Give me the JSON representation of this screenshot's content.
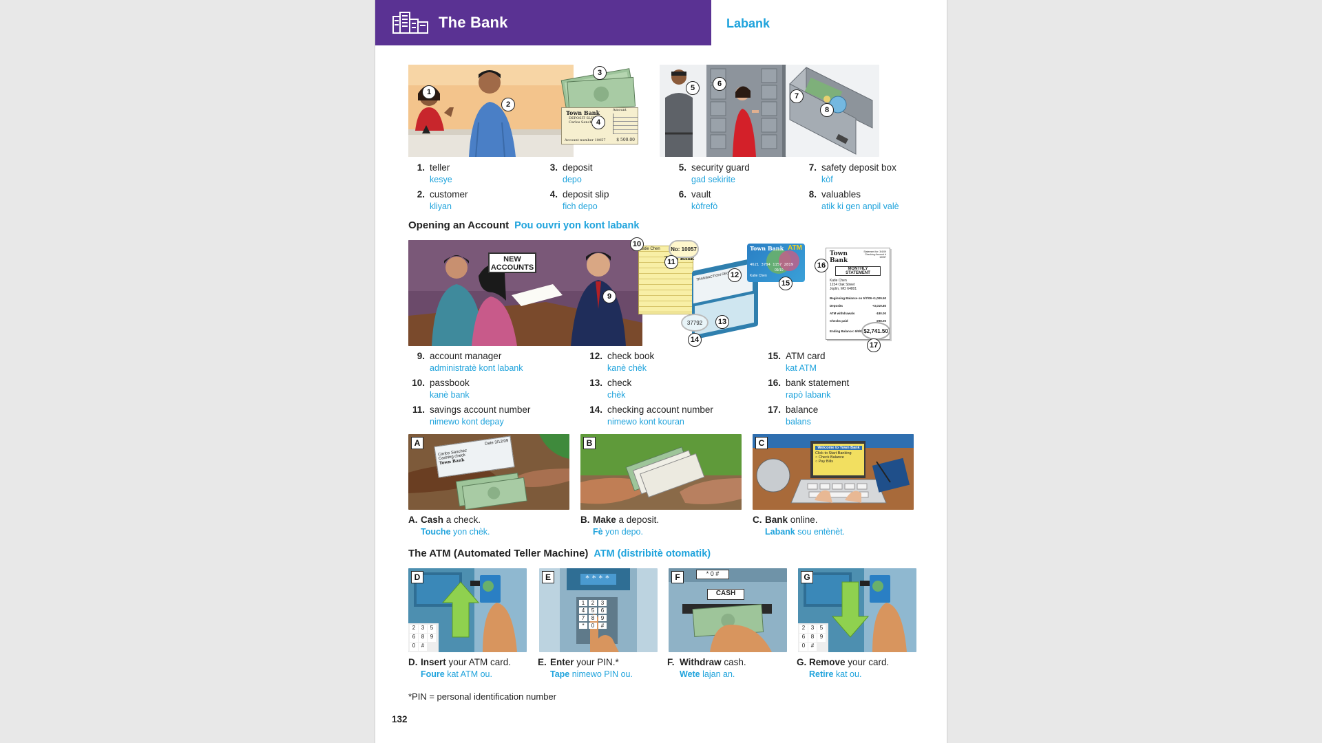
{
  "header": {
    "title": "The Bank",
    "title_ht": "Labank"
  },
  "section1": {
    "terms": [
      {
        "num": "1.",
        "en": "teller",
        "ht": "kesye"
      },
      {
        "num": "2.",
        "en": "customer",
        "ht": "kliyan"
      },
      {
        "num": "3.",
        "en": "deposit",
        "ht": "depo"
      },
      {
        "num": "4.",
        "en": "deposit slip",
        "ht": "fich depo"
      },
      {
        "num": "5.",
        "en": "security guard",
        "ht": "gad sekirite"
      },
      {
        "num": "6.",
        "en": "vault",
        "ht": "kòfrefò"
      },
      {
        "num": "7.",
        "en": "safety deposit box",
        "ht": "kòf"
      },
      {
        "num": "8.",
        "en": "valuables",
        "ht": "atik ki gen anpil valè"
      }
    ],
    "slip": {
      "bank": "Town Bank",
      "label": "DEPOSIT SLIP",
      "name": "Carlos Sanchez",
      "account_label": "Account number",
      "account": "10057",
      "amount": "500.00",
      "currency": "$",
      "amount_header": "Amount"
    }
  },
  "section2": {
    "heading": "Opening an Account",
    "heading_ht": "Pou ouvri yon kont labank",
    "sign": "NEW ACCOUNTS",
    "passbook": {
      "no": "No: 10057",
      "name": "Katie Chen",
      "bank": "Town Bank"
    },
    "checkbook": {
      "label": "TRANSACTION REGISTER",
      "account": "37792"
    },
    "atm_card": {
      "bank": "Town Bank",
      "brand": "ATM",
      "number": "4621 3784 1157 2819",
      "exp": "09/10",
      "name": "Katie Chen"
    },
    "statement": {
      "bank": "Town Bank",
      "statement_for": "Statement for: 3/4/09",
      "checking_account": "Checking Account # 10057",
      "title": "MONTHLY STATEMENT",
      "address": [
        "Katie Chen",
        "1234 Oak Street",
        "Joplin, MO 64801"
      ],
      "rows": [
        {
          "label": "Beginning Balance on 5/7/09",
          "value": "+1,009.50"
        },
        {
          "label": "Deposits",
          "value": "+3,019.80"
        },
        {
          "label": "ATM withdrawals",
          "value": "-180.00"
        },
        {
          "label": "Checks paid",
          "value": "-298.00"
        },
        {
          "label": "Ending Balance: 6/9/09",
          "value": ""
        }
      ],
      "balance": "$2,741.50"
    },
    "terms": [
      {
        "num": "9.",
        "en": "account manager",
        "ht": "administratè kont labank"
      },
      {
        "num": "10.",
        "en": "passbook",
        "ht": "kanè bank"
      },
      {
        "num": "11.",
        "en": "savings account number",
        "ht": "nimewo kont depay"
      },
      {
        "num": "12.",
        "en": "check book",
        "ht": "kanè chèk"
      },
      {
        "num": "13.",
        "en": "check",
        "ht": "chèk"
      },
      {
        "num": "14.",
        "en": "checking account number",
        "ht": "nimewo kont kouran"
      },
      {
        "num": "15.",
        "en": "ATM card",
        "ht": "kat ATM"
      },
      {
        "num": "16.",
        "en": "bank statement",
        "ht": "rapò labank"
      },
      {
        "num": "17.",
        "en": "balance",
        "ht": "balans"
      }
    ]
  },
  "actions1": [
    {
      "letter": "A.",
      "tag": "A",
      "verb": "Cash",
      "rest": " a check.",
      "verb_ht": "Touche",
      "rest_ht": " yon chèk."
    },
    {
      "letter": "B.",
      "tag": "B",
      "verb": "Make",
      "rest": " a deposit.",
      "verb_ht": "Fè",
      "rest_ht": " yon depo."
    },
    {
      "letter": "C.",
      "tag": "C",
      "verb": "Bank",
      "rest": " online.",
      "verb_ht": "Labank",
      "rest_ht": " sou entènèt."
    }
  ],
  "online_screen": {
    "title": "Welcome to Town Bank",
    "line1": "Click to Start Banking",
    "opt1": "Check Balance",
    "opt2": "Pay Bills"
  },
  "check_a": {
    "pay_to": "Carlos Sanchez",
    "bank": "Town Bank",
    "memo": "Cashing check",
    "date": "Date 3/12/09"
  },
  "section3": {
    "heading": "The ATM (Automated Teller Machine)",
    "heading_ht": "ATM (distribitè otomatik)"
  },
  "actions2": [
    {
      "letter": "D.",
      "tag": "D",
      "verb": "Insert",
      "rest": " your ATM card.",
      "verb_ht": "Foure",
      "rest_ht": " kat ATM ou."
    },
    {
      "letter": "E.",
      "tag": "E",
      "verb": "Enter",
      "rest": " your PIN.*",
      "verb_ht": "Tape",
      "rest_ht": " nimewo PIN ou."
    },
    {
      "letter": "F.",
      "tag": "F",
      "verb": "Withdraw",
      "rest": " cash.",
      "verb_ht": "Wete",
      "rest_ht": " lajan an."
    },
    {
      "letter": "G.",
      "tag": "G",
      "verb": "Remove",
      "rest": " your card.",
      "verb_ht": "Retire",
      "rest_ht": " kat ou."
    }
  ],
  "atm": {
    "pin_mask": "****",
    "cash_label": "CASH",
    "keys": [
      "1",
      "2",
      "3",
      "4",
      "5",
      "6",
      "7",
      "8",
      "9",
      "*",
      "0",
      "#"
    ]
  },
  "footnote": "*PIN = personal identification number",
  "page_number": "132",
  "colors": {
    "header_purple": "#5a3293",
    "haitian_blue": "#1fa3dc",
    "atm_teal": "#4d8fb0"
  }
}
